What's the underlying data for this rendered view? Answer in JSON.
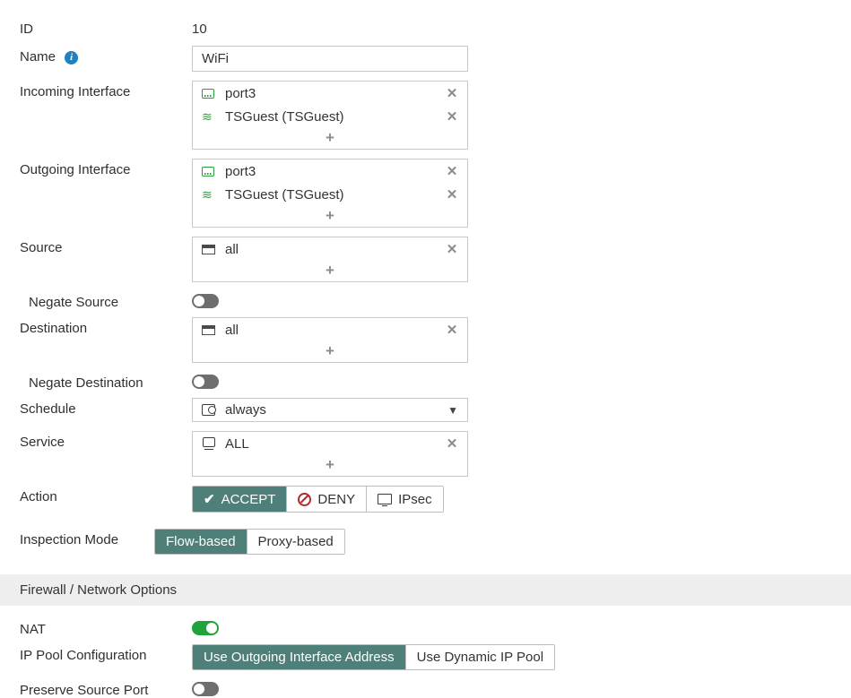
{
  "labels": {
    "id": "ID",
    "name": "Name",
    "incoming": "Incoming Interface",
    "outgoing": "Outgoing Interface",
    "source": "Source",
    "negSource": "Negate Source",
    "destination": "Destination",
    "negDest": "Negate Destination",
    "schedule": "Schedule",
    "service": "Service",
    "action": "Action",
    "inspection": "Inspection Mode",
    "sectionNet": "Firewall / Network Options",
    "nat": "NAT",
    "ippool": "IP Pool Configuration",
    "preservePort": "Preserve Source Port"
  },
  "idValue": "10",
  "nameValue": "WiFi",
  "incoming": {
    "items": [
      {
        "icon": "eth",
        "text": "port3"
      },
      {
        "icon": "wifi",
        "text": "TSGuest (TSGuest)"
      }
    ]
  },
  "outgoing": {
    "items": [
      {
        "icon": "eth",
        "text": "port3"
      },
      {
        "icon": "wifi",
        "text": "TSGuest (TSGuest)"
      }
    ]
  },
  "source": {
    "items": [
      {
        "icon": "addr",
        "text": "all"
      }
    ]
  },
  "destination": {
    "items": [
      {
        "icon": "addr",
        "text": "all"
      }
    ]
  },
  "scheduleValue": "always",
  "service": {
    "items": [
      {
        "icon": "svc",
        "text": "ALL"
      }
    ]
  },
  "actionOptions": {
    "accept": "ACCEPT",
    "deny": "DENY",
    "ipsec": "IPsec"
  },
  "inspectionOptions": {
    "flow": "Flow-based",
    "proxy": "Proxy-based"
  },
  "ippoolOptions": {
    "outgoing": "Use Outgoing Interface Address",
    "dynamic": "Use Dynamic IP Pool"
  },
  "toggles": {
    "negSource": false,
    "negDest": false,
    "nat": true,
    "preservePort": false
  },
  "glyphs": {
    "plus": "+",
    "remove": "✕",
    "caretDown": "▼",
    "check": "✔",
    "wifi": "≋"
  }
}
